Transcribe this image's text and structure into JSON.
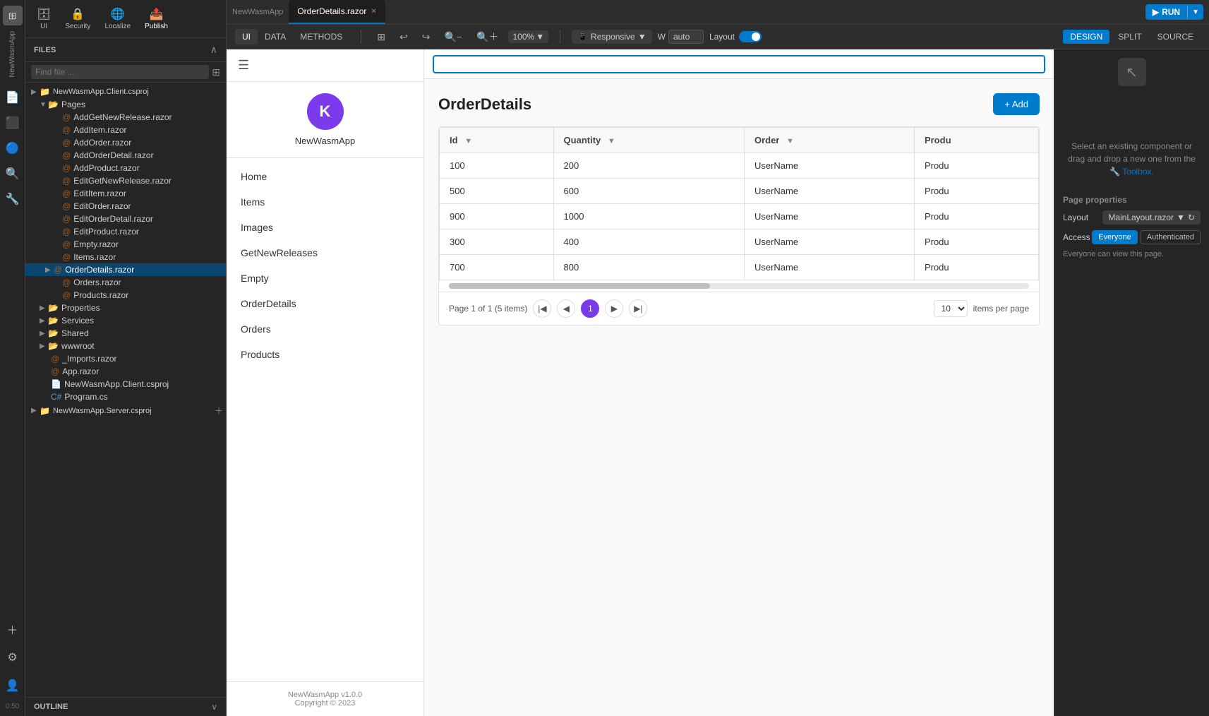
{
  "app": {
    "title": "NewWasmApp",
    "tab_label": "OrderDetails.razor",
    "run_btn": "RUN"
  },
  "toolbar": {
    "tabs": [
      "UI",
      "DATA",
      "METHODS"
    ],
    "zoom": "100%",
    "responsive_label": "Responsive",
    "w_label": "W",
    "w_value": "auto",
    "layout_label": "Layout",
    "view_tabs": [
      "DESIGN",
      "SPLIT",
      "SOURCE"
    ]
  },
  "file_panel": {
    "header": "FILES",
    "search_placeholder": "Find file ...",
    "projects": [
      {
        "name": "NewWasmApp.Client.csproj",
        "items": [
          {
            "name": "Pages",
            "type": "folder",
            "items": [
              {
                "name": "AddGetNewRelease.razor",
                "type": "razor"
              },
              {
                "name": "AddItem.razor",
                "type": "razor"
              },
              {
                "name": "AddOrder.razor",
                "type": "razor"
              },
              {
                "name": "AddOrderDetail.razor",
                "type": "razor"
              },
              {
                "name": "AddProduct.razor",
                "type": "razor"
              },
              {
                "name": "EditGetNewRelease.razor",
                "type": "razor"
              },
              {
                "name": "EditItem.razor",
                "type": "razor"
              },
              {
                "name": "EditOrder.razor",
                "type": "razor"
              },
              {
                "name": "EditOrderDetail.razor",
                "type": "razor"
              },
              {
                "name": "EditProduct.razor",
                "type": "razor"
              },
              {
                "name": "Empty.razor",
                "type": "razor"
              },
              {
                "name": "Items.razor",
                "type": "razor"
              },
              {
                "name": "OrderDetails.razor",
                "type": "razor",
                "selected": true
              },
              {
                "name": "Orders.razor",
                "type": "razor"
              },
              {
                "name": "Products.razor",
                "type": "razor"
              }
            ]
          },
          {
            "name": "Properties",
            "type": "folder"
          },
          {
            "name": "Services",
            "type": "folder"
          },
          {
            "name": "Shared",
            "type": "folder"
          },
          {
            "name": "wwwroot",
            "type": "folder"
          },
          {
            "name": "_Imports.razor",
            "type": "razor"
          },
          {
            "name": "App.razor",
            "type": "razor"
          },
          {
            "name": "NewWasmApp.Client.csproj",
            "type": "project"
          },
          {
            "name": "Program.cs",
            "type": "cs"
          }
        ]
      },
      {
        "name": "NewWasmApp.Server.csproj",
        "type": "project"
      }
    ]
  },
  "outline": {
    "label": "OUTLINE"
  },
  "preview": {
    "app_name": "NewWasmApp",
    "logo_letter": "K",
    "nav_items": [
      "Home",
      "Items",
      "Images",
      "GetNewReleases",
      "Empty",
      "OrderDetails",
      "Orders",
      "Products"
    ],
    "footer_line1": "NewWasmApp v1.0.0",
    "footer_line2": "Copyright © 2023"
  },
  "table": {
    "title": "OrderDetails",
    "add_btn": "+ Add",
    "columns": [
      "Id",
      "Quantity",
      "Order",
      "Produ"
    ],
    "rows": [
      {
        "id": "100",
        "quantity": "200",
        "order": "UserName",
        "product": "Produ"
      },
      {
        "id": "500",
        "quantity": "600",
        "order": "UserName",
        "product": "Produ"
      },
      {
        "id": "900",
        "quantity": "1000",
        "order": "UserName",
        "product": "Produ"
      },
      {
        "id": "300",
        "quantity": "400",
        "order": "UserName",
        "product": "Produ"
      },
      {
        "id": "700",
        "quantity": "800",
        "order": "UserName",
        "product": "Produ"
      }
    ],
    "pagination": {
      "page_info": "Page 1 of 1 (5 items)",
      "current_page": "1",
      "per_page": "10",
      "items_per_page_label": "items per page"
    }
  },
  "right_panel": {
    "hint_text": "Select an existing component or drag and drop a new one from the",
    "toolbox_text": "Toolbox.",
    "properties_title": "Page properties",
    "layout_label": "Layout",
    "layout_value": "MainLayout.razor",
    "access_label": "Access",
    "access_options": [
      "Everyone",
      "Authenticated"
    ],
    "access_active": "Everyone",
    "access_note": "Everyone can view this page."
  }
}
